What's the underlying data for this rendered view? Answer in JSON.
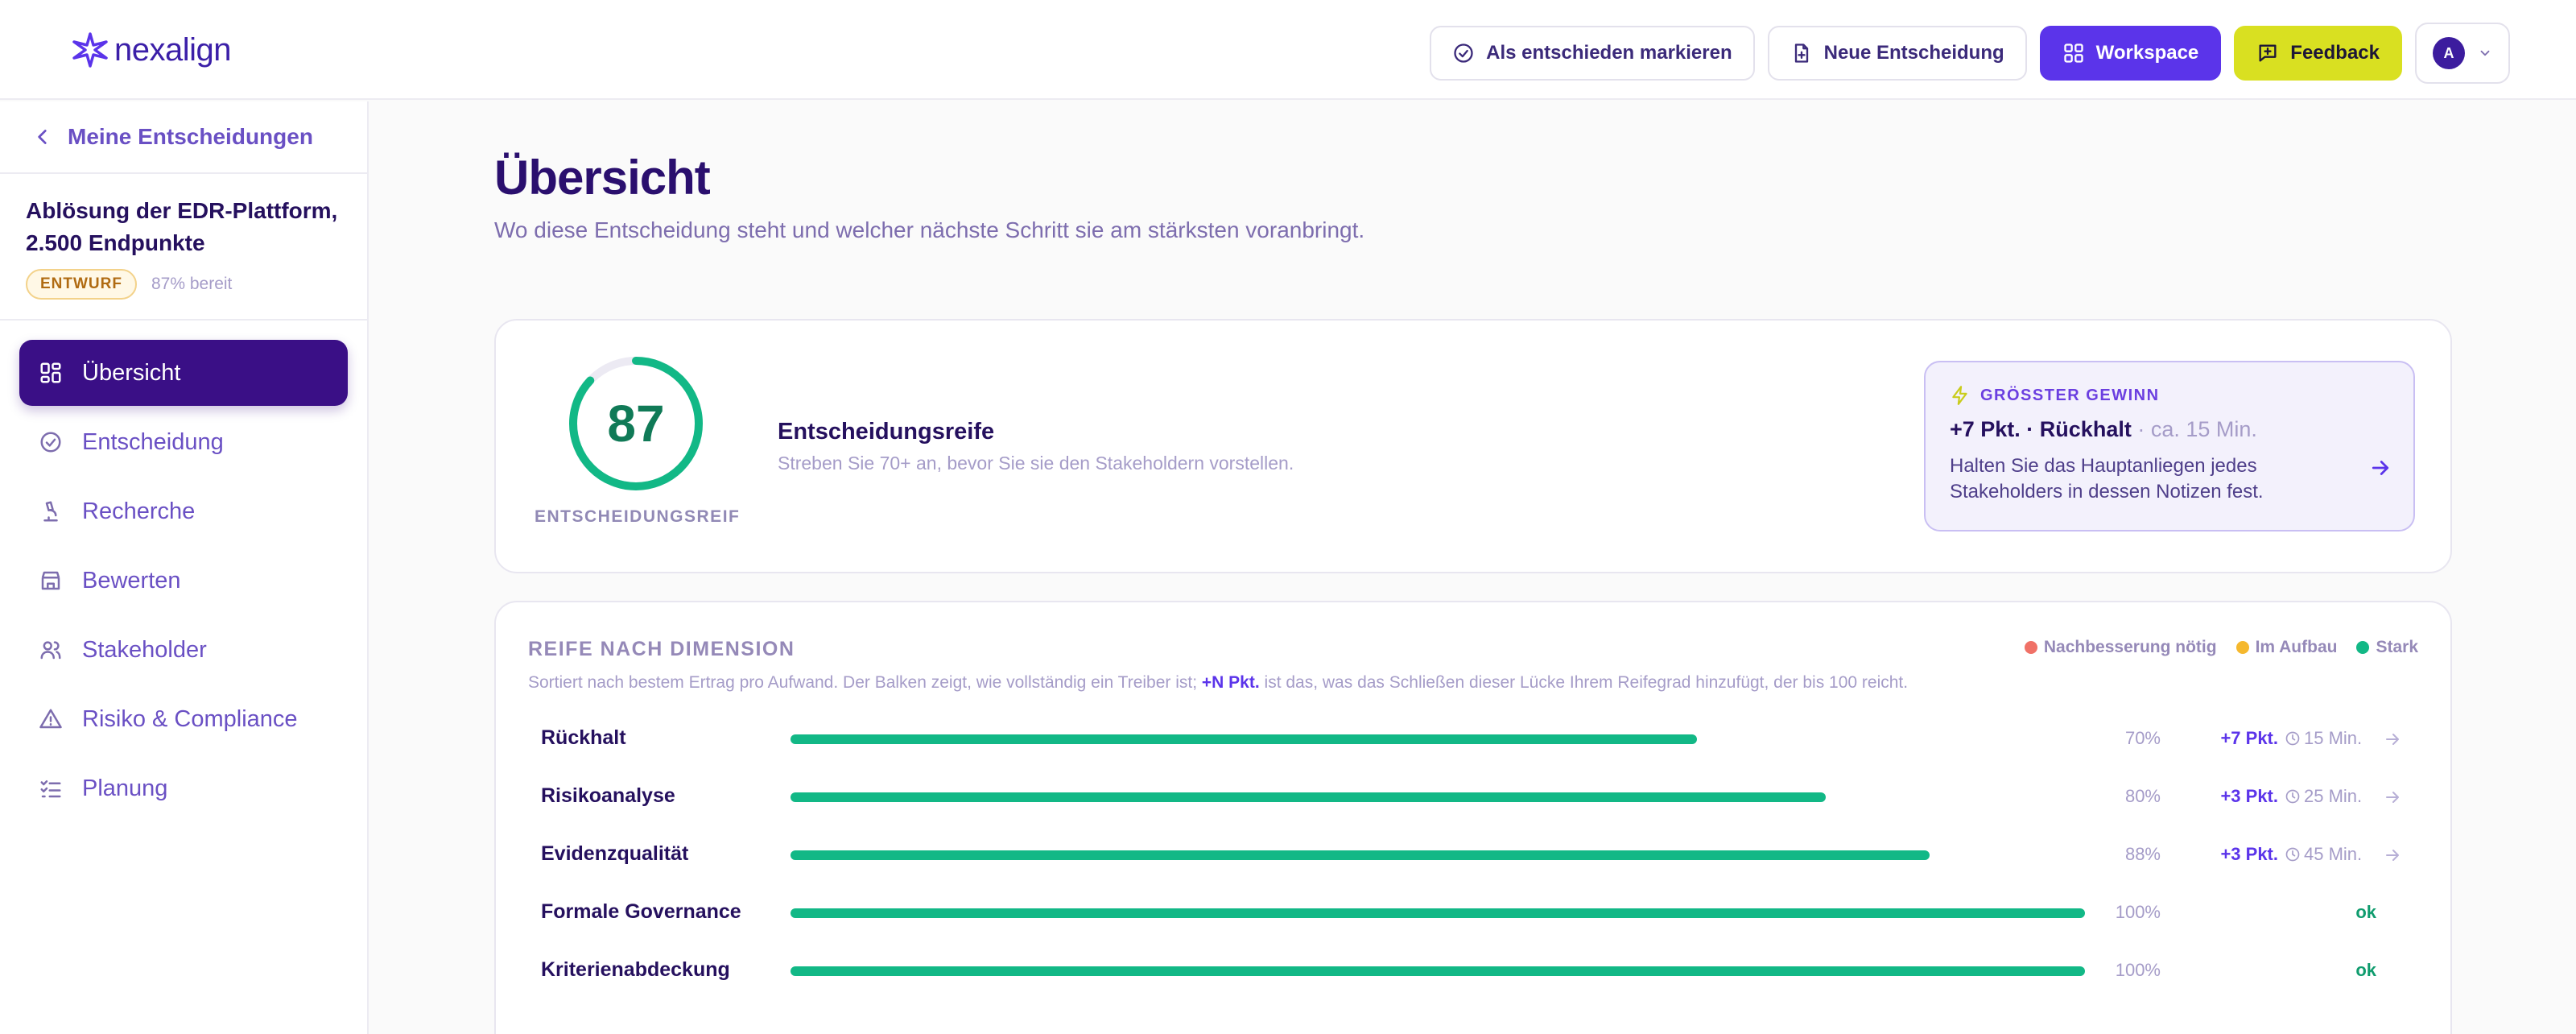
{
  "header": {
    "logo_text": "nexalign",
    "buttons": {
      "mark_decided": "Als entschieden markieren",
      "new_decision": "Neue Entscheidung",
      "workspace": "Workspace",
      "feedback": "Feedback"
    },
    "user_initial": "A"
  },
  "sidebar": {
    "back_label": "Meine Entscheidungen",
    "project_title": "Ablösung der EDR-Plattform, 2.500 Endpunkte",
    "status_badge": "ENTWURF",
    "ready_text": "87% bereit",
    "items": [
      {
        "label": "Übersicht",
        "icon": "grid-icon",
        "active": true
      },
      {
        "label": "Entscheidung",
        "icon": "check-circle-icon",
        "active": false
      },
      {
        "label": "Recherche",
        "icon": "microscope-icon",
        "active": false
      },
      {
        "label": "Bewerten",
        "icon": "store-icon",
        "active": false
      },
      {
        "label": "Stakeholder",
        "icon": "users-icon",
        "active": false
      },
      {
        "label": "Risiko & Compliance",
        "icon": "warning-icon",
        "active": false
      },
      {
        "label": "Planung",
        "icon": "list-checks-icon",
        "active": false
      }
    ]
  },
  "main": {
    "title": "Übersicht",
    "subtitle": "Wo diese Entscheidung steht und welcher nächste Schritt sie am stärksten voranbringt.",
    "score": {
      "value": "87",
      "fraction": 0.87,
      "label": "ENTSCHEIDUNGSREIF",
      "title": "Entscheidungsreife",
      "subtitle": "Streben Sie 70+ an, bevor Sie sie den Stakeholdern vorstellen."
    },
    "gain": {
      "heading": "GRÖSSTER GEWINN",
      "value": "+7 Pkt. · Rückhalt",
      "time": " · ca. 15 Min.",
      "text": "Halten Sie das Hauptanliegen jedes Stakeholders in dessen Notizen fest."
    },
    "dimensions": {
      "title": "REIFE NACH DIMENSION",
      "legend": [
        {
          "label": "Nachbesserung nötig",
          "color": "#f07167"
        },
        {
          "label": "Im Aufbau",
          "color": "#f5b82e"
        },
        {
          "label": "Stark",
          "color": "#12b886"
        }
      ],
      "desc_before": "Sortiert nach bestem Ertrag pro Aufwand. Der Balken zeigt, wie vollständig ein Treiber ist; ",
      "desc_highlight": "+N Pkt.",
      "desc_after": " ist das, was das Schließen dieser Lücke Ihrem Reifegrad hinzufügt, der bis 100 reicht.",
      "rows": [
        {
          "name": "Rückhalt",
          "value": 0.7,
          "pct": "70%",
          "gain": "+7 Pkt.",
          "time": "15 Min."
        },
        {
          "name": "Risikoanalyse",
          "value": 0.8,
          "pct": "80%",
          "gain": "+3 Pkt.",
          "time": "25 Min."
        },
        {
          "name": "Evidenzqualität",
          "value": 0.88,
          "pct": "88%",
          "gain": "+3 Pkt.",
          "time": "45 Min."
        },
        {
          "name": "Formale Governance",
          "value": 1.0,
          "pct": "100%",
          "ok": "ok"
        },
        {
          "name": "Kriterienabdeckung",
          "value": 1.0,
          "pct": "100%",
          "ok": "ok"
        }
      ]
    }
  },
  "colors": {
    "accent": "#5b34ea",
    "active_nav": "#3a0f86",
    "progress": "#12b886",
    "feedback": "#d9e021"
  }
}
